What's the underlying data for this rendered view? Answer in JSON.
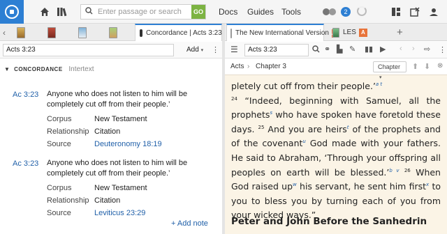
{
  "toolbar": {
    "search_placeholder": "Enter passage or search",
    "go_label": "GO",
    "nav": [
      "Docs",
      "Guides",
      "Tools"
    ],
    "notification_count": "2"
  },
  "left_tabs": {
    "active_label": "Concordance | Acts 3:23"
  },
  "right_tabs": {
    "active_label": "The New International Version",
    "active_lang": "A",
    "second_label": "LES",
    "second_lang": "A",
    "add": "+"
  },
  "left_subbar": {
    "reference": "Acts 3:23",
    "add_label": "Add"
  },
  "right_subbar": {
    "reference": "Acts 3:23"
  },
  "concordance": {
    "title": "CONCORDANCE",
    "subtitle": "Intertext",
    "entries": [
      {
        "ref": "Ac 3:23",
        "text": "Anyone who does not listen to him will be completely cut off from their people.’",
        "props": [
          {
            "label": "Corpus",
            "value": "New Testament"
          },
          {
            "label": "Relationship",
            "value": "Citation"
          },
          {
            "label": "Source",
            "value": "Deuteronomy 18:19"
          }
        ]
      },
      {
        "ref": "Ac 3:23",
        "text": "Anyone who does not listen to him will be completely cut off from their people.’",
        "props": [
          {
            "label": "Corpus",
            "value": "New Testament"
          },
          {
            "label": "Relationship",
            "value": "Citation"
          },
          {
            "label": "Source",
            "value": "Leviticus 23:29"
          }
        ]
      }
    ],
    "add_note": "+ Add note"
  },
  "reader": {
    "breadcrumb_book": "Acts",
    "breadcrumb_sep": "›",
    "breadcrumb_chapter": "Chapter 3",
    "chapter_button": "Chapter",
    "heading": "Peter and John Before the Sanhedrin",
    "p1": "pletely cut off from their people.’",
    "v24": "24",
    "p2": " “Indeed, beginning with Samuel, all the prophets",
    "fn_s": "s",
    "p3": " who have spoken have foretold these days. ",
    "v25": "25",
    "p4": " And you are heirs",
    "fn_t": "t",
    "p5": " of the prophets and of the covenant",
    "fn_u": "u",
    "p6": " God made with your fathers. He said to Abraham, ‘Through your offspring all peoples on earth will be blessed.’",
    "fn_bv": "b v",
    "v26": "26",
    "p7": " When God raised up",
    "fn_w": "w",
    "p8": " his servant, he sent him first",
    "fn_x": "x",
    "p9": " to you to bless you by turning each of you from your wicked ways.”",
    "fn_at": "a t"
  }
}
